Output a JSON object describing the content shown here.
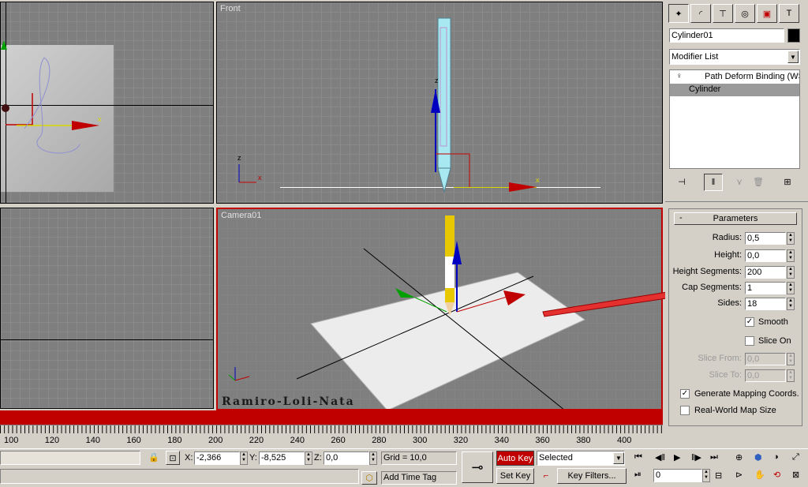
{
  "viewports": {
    "front_label": "Front",
    "camera_label": "Camera01",
    "watermark": "Ramiro-Loli-Nata",
    "axis_x": "x",
    "axis_z": "z"
  },
  "panel": {
    "object_name": "Cylinder01",
    "modifier_list": "Modifier List",
    "stack": [
      "Path Deform Binding (WS",
      "Cylinder"
    ],
    "rollout_title": "Parameters",
    "rollout_toggle": "-",
    "params": {
      "radius_label": "Radius:",
      "radius_value": "0,5",
      "height_label": "Height:",
      "height_value": "0,0",
      "hseg_label": "Height Segments:",
      "hseg_value": "200",
      "capseg_label": "Cap Segments:",
      "capseg_value": "1",
      "sides_label": "Sides:",
      "sides_value": "18",
      "smooth_label": "Smooth",
      "slice_on_label": "Slice On",
      "slice_from_label": "Slice From:",
      "slice_from_value": "0,0",
      "slice_to_label": "Slice To:",
      "slice_to_value": "0,0",
      "gen_map_label": "Generate Mapping Coords.",
      "realworld_label": "Real-World Map Size"
    }
  },
  "timeline": {
    "ticks": [
      "100",
      "120",
      "140",
      "160",
      "180",
      "200",
      "220",
      "240",
      "260",
      "280",
      "300",
      "320",
      "340",
      "360",
      "380",
      "400"
    ]
  },
  "status": {
    "x_label": "X:",
    "x_value": "-2,366",
    "y_label": "Y:",
    "y_value": "-8,525",
    "z_label": "Z:",
    "z_value": "0,0",
    "grid": "Grid = 10,0",
    "add_time_tag": "Add Time Tag",
    "auto_key": "Auto Key",
    "selected": "Selected",
    "set_key": "Set Key",
    "key_filters": "Key Filters...",
    "frame": "0"
  },
  "colors": {
    "accent_red": "#c00000",
    "viewport_bg": "#7f7f7f"
  }
}
